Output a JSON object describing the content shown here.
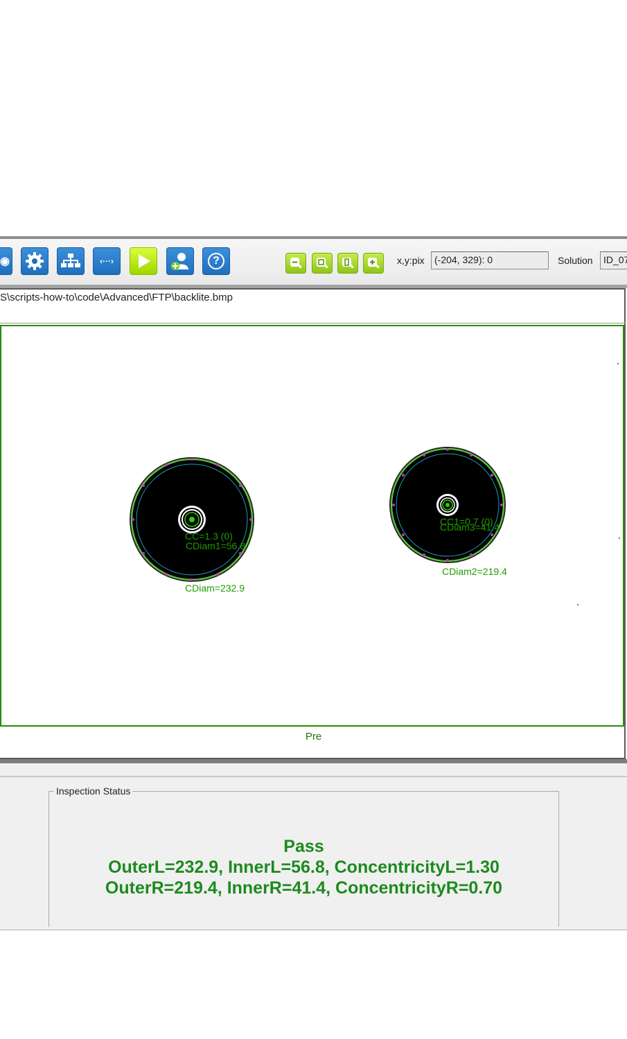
{
  "toolbar": {
    "buttons": [
      {
        "icon": "eye-icon"
      },
      {
        "icon": "gear-icon"
      },
      {
        "icon": "hierarchy-icon"
      },
      {
        "icon": "code-icon",
        "glyph": "‹···›"
      },
      {
        "icon": "play-icon"
      },
      {
        "icon": "add-user-icon"
      },
      {
        "icon": "help-icon",
        "glyph": "?"
      }
    ],
    "zoom_buttons": [
      "zoom-out-icon",
      "zoom-fit-icon",
      "zoom-actual-icon",
      "zoom-in-icon"
    ],
    "xy_label": "x,y:pix",
    "xy_value": "(-204, 329): 0",
    "solution_label": "Solution",
    "solution_value": "ID_07"
  },
  "image": {
    "file_path": "S\\scripts-how-to\\code\\Advanced\\FTP\\backlite.bmp",
    "caption": "Pre",
    "annotations": {
      "left_cc": "CC=1.3 (0)",
      "left_cdiam1": "CDiam1=56.8",
      "left_cdiam": "CDiam=232.9",
      "right_cc1": "CC1=0.7 (0)",
      "right_cdiam3": "CDiam3=41.4",
      "right_cdiam2": "CDiam2=219.4"
    }
  },
  "status": {
    "title": "Inspection Status",
    "result": "Pass",
    "line_left": "OuterL=232.9, InnerL=56.8, ConcentricityL=1.30",
    "line_right": "OuterR=219.4, InnerR=41.4, ConcentricityR=0.70"
  },
  "colors": {
    "pass_green": "#1d8a1d",
    "annotation_green": "#1f9a00",
    "toolbar_blue": "#1f6fbd",
    "toolbar_lime": "#9ed600"
  }
}
